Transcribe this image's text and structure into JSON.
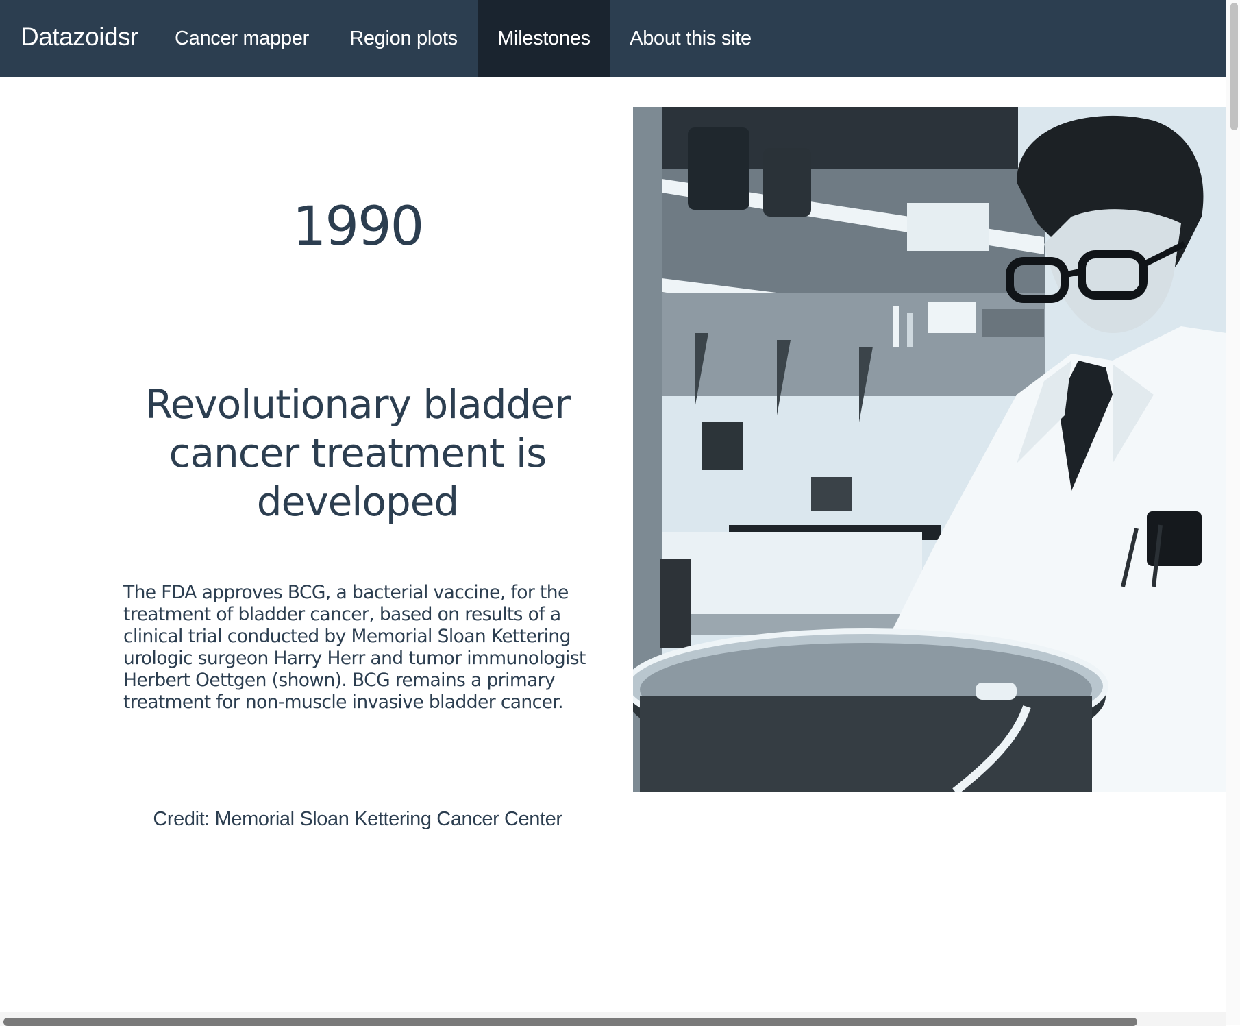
{
  "navbar": {
    "brand": "Datazoidsr",
    "items": [
      {
        "label": "Cancer mapper",
        "active": false
      },
      {
        "label": "Region plots",
        "active": false
      },
      {
        "label": "Milestones",
        "active": true
      },
      {
        "label": "About this site",
        "active": false
      }
    ]
  },
  "milestone": {
    "year": "1990",
    "headline": "Revolutionary bladder cancer treatment is developed",
    "description": "The FDA approves BCG, a bacterial vaccine, for the treatment of bladder cancer, based on results of a clinical trial conducted by Memorial Sloan Kettering urologic surgeon Harry Herr and tumor immunologist Herbert Oettgen (shown). BCG remains a primary treatment for non-muscle invasive bladder cancer.",
    "credit": "Credit: Memorial Sloan Kettering Cancer Center"
  },
  "colors": {
    "navbar_bg": "#2c3e50",
    "navbar_active_bg": "#1a242f",
    "text": "#2c3e50",
    "photo_tint": "#dde9f0"
  }
}
